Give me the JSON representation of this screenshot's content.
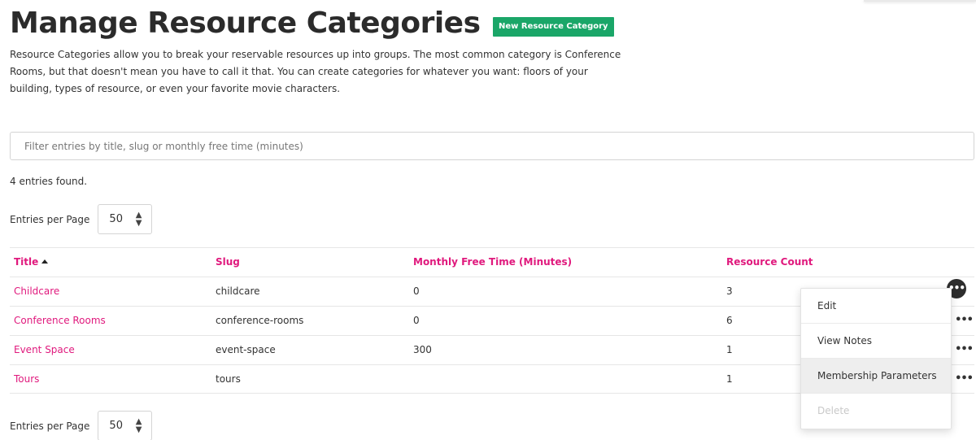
{
  "page": {
    "title": "Manage Resource Categories",
    "new_button": "New Resource Category",
    "intro": "Resource Categories allow you to break your reservable resources up into groups. The most common category is Conference Rooms, but that doesn't mean you have to call it that. You can create categories for whatever you want: floors of your building, types of resource, or even your favorite movie characters."
  },
  "filter": {
    "placeholder": "Filter entries by title, slug or monthly free time (minutes)",
    "value": ""
  },
  "entries_found": "4 entries found.",
  "pagination": {
    "label": "Entries per Page",
    "selected": "50"
  },
  "table": {
    "columns": [
      "Title",
      "Slug",
      "Monthly Free Time (Minutes)",
      "Resource Count"
    ],
    "sorted_by": "Title",
    "sort_direction": "ascending",
    "rows": [
      {
        "title": "Childcare",
        "slug": "childcare",
        "free_time": "0",
        "count": "3"
      },
      {
        "title": "Conference Rooms",
        "slug": "conference-rooms",
        "free_time": "0",
        "count": "6"
      },
      {
        "title": "Event Space",
        "slug": "event-space",
        "free_time": "300",
        "count": "1"
      },
      {
        "title": "Tours",
        "slug": "tours",
        "free_time": "",
        "count": "1"
      }
    ]
  },
  "row_menu": {
    "open_row": "Childcare",
    "items": [
      "Edit",
      "View Notes",
      "Membership Parameters",
      "Delete"
    ],
    "hovered": "Membership Parameters",
    "disabled": "Delete"
  },
  "icons": {
    "more": "more-horizontal-icon",
    "sort": "sort-ascending-icon",
    "select": "select-arrows-icon"
  },
  "colors": {
    "accent": "#e0197d",
    "primary_button": "#1aa668"
  }
}
